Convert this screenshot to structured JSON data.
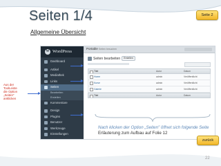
{
  "slide": {
    "title": "Seiten 1/4",
    "subtitle": "Allgemeine Übersicht",
    "nav_next": "Seite 2",
    "nav_back": "zurück",
    "side_note": "Aus der\nToolLeiste\ndie Option\n„Seiten\"\nanklicken",
    "caption_italic": "Nach klicken der Option „Seiten\" öffnet sich folgende Seite",
    "caption": "Erläuterung zum Aufbau auf Folie 12",
    "page_number": "22"
  },
  "wp": {
    "logo": "WordPress",
    "site_title": "Portable",
    "site_title_suffix": "Seiten besuchen",
    "page_heading": "Seiten bearbeiten",
    "page_heading_button": "Erstellen",
    "menu": [
      {
        "label": "Dashboard",
        "active": false,
        "sub": false,
        "icon": "dashboard-icon"
      },
      {
        "label": "Artikel",
        "active": false,
        "sub": false,
        "icon": "pin-icon"
      },
      {
        "label": "Mediathek",
        "active": false,
        "sub": false,
        "icon": "media-icon"
      },
      {
        "label": "Links",
        "active": false,
        "sub": false,
        "icon": "link-icon"
      },
      {
        "label": "Seiten",
        "active": true,
        "sub": false,
        "icon": "page-icon"
      },
      {
        "label": "Bearbeiten",
        "active": false,
        "sub": true,
        "icon": ""
      },
      {
        "label": "Erstellen",
        "active": false,
        "sub": true,
        "icon": ""
      },
      {
        "label": "Kommentare",
        "active": false,
        "sub": false,
        "icon": "comment-icon"
      },
      {
        "label": "Design",
        "active": false,
        "sub": false,
        "icon": "design-icon"
      },
      {
        "label": "Plugins",
        "active": false,
        "sub": false,
        "icon": "plugin-icon"
      },
      {
        "label": "Benutzer",
        "active": false,
        "sub": false,
        "icon": "users-icon"
      },
      {
        "label": "Werkzeuge",
        "active": false,
        "sub": false,
        "icon": "tools-icon"
      },
      {
        "label": "Einstellungen",
        "active": false,
        "sub": false,
        "icon": "settings-icon"
      }
    ],
    "table": {
      "headers": [
        "Titel",
        "Autor",
        "Datum"
      ],
      "rows": [
        {
          "title": "Home",
          "author": "admin",
          "date": "Veröffentlicht"
        },
        {
          "title": "Kurse",
          "author": "admin",
          "date": "Veröffentlicht"
        },
        {
          "title": "Galerie",
          "author": "admin",
          "date": "Veröffentlicht"
        }
      ],
      "footer": [
        "Titel",
        "Autor",
        "Datum"
      ]
    }
  },
  "colors": {
    "title": "#3a4f5e",
    "side_note": "#cc2a1b",
    "caption_italic": "#5d88b8",
    "arrow": "#3f6ed0",
    "nav_button": "#f3b72a"
  }
}
